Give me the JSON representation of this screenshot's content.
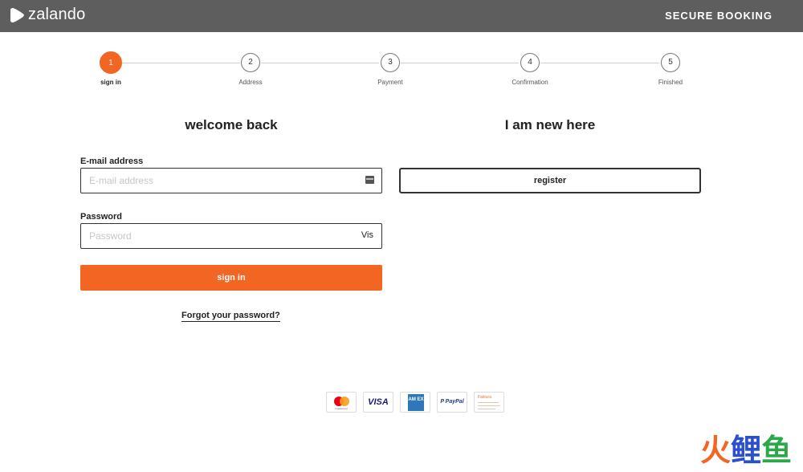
{
  "header": {
    "logo_text": "zalando",
    "secure_label": "SECURE BOOKING"
  },
  "stepper": {
    "steps": [
      {
        "number": "1",
        "label": "sign in",
        "active": true
      },
      {
        "number": "2",
        "label": "Address",
        "active": false
      },
      {
        "number": "3",
        "label": "Payment",
        "active": false
      },
      {
        "number": "4",
        "label": "Confirmation",
        "active": false
      },
      {
        "number": "5",
        "label": "Finished",
        "active": false
      }
    ]
  },
  "login": {
    "title": "welcome back",
    "email_label": "E-mail address",
    "email_placeholder": "E-mail address",
    "email_value": "",
    "password_label": "Password",
    "password_placeholder": "Password",
    "password_value": "",
    "visibility_toggle": "Vis",
    "signin_label": "sign in",
    "forgot_label": "Forgot your password?"
  },
  "register": {
    "title": "I am new here",
    "button_label": "register"
  },
  "payments": {
    "methods": [
      "mastercard",
      "VISA",
      "AMEX",
      "PayPal",
      "Faktura"
    ],
    "mastercard_text": "mastercard",
    "visa_text": "VISA",
    "amex_text": "AM EX",
    "paypal_text": "P PayPal",
    "faktura_text": "Faktura"
  },
  "watermark": {
    "chars": [
      "火",
      "鲤",
      "鱼"
    ]
  },
  "colors": {
    "header_bg": "#5e5e5e",
    "accent": "#f26522",
    "text": "#222222"
  }
}
